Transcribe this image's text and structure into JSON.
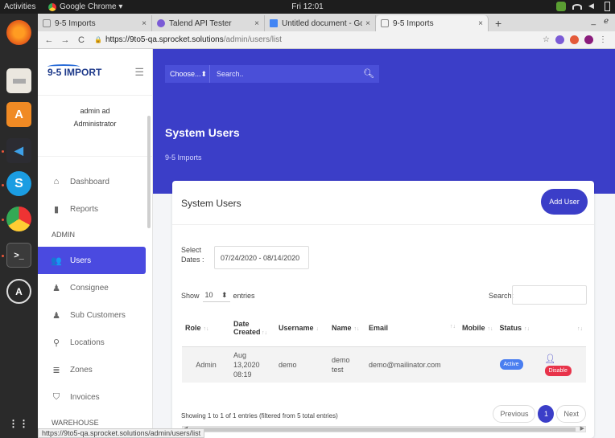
{
  "os": {
    "activities": "Activities",
    "app_name": "Google Chrome ▾",
    "clock": "Fri 12:01"
  },
  "tabs": [
    {
      "label": "9-5 Imports",
      "active": false
    },
    {
      "label": "Talend API Tester",
      "active": false
    },
    {
      "label": "Untitled document - Goog",
      "active": false
    },
    {
      "label": "9-5 Imports",
      "active": true
    }
  ],
  "address": {
    "domain": "https://9to5-qa.sprocket.solutions",
    "path": "/admin/users/list"
  },
  "sidebar": {
    "logo": "9-5 IMPORT",
    "user_name": "admin ad",
    "user_role": "Administrator",
    "items": [
      {
        "label": "Dashboard",
        "icon": "home-icon"
      },
      {
        "label": "Reports",
        "icon": "document-icon"
      }
    ],
    "section_admin": "ADMIN",
    "admin_items": [
      {
        "label": "Users",
        "icon": "users-icon",
        "active": true
      },
      {
        "label": "Consignee",
        "icon": "person-icon"
      },
      {
        "label": "Sub Customers",
        "icon": "person-icon"
      },
      {
        "label": "Locations",
        "icon": "map-pin-icon"
      },
      {
        "label": "Zones",
        "icon": "list-icon"
      },
      {
        "label": "Invoices",
        "icon": "shield-icon"
      }
    ],
    "section_warehouse": "WAREHOUSE"
  },
  "topnav": {
    "choose": "Choose...",
    "search_placeholder": "Search.."
  },
  "hero": {
    "title": "System Users",
    "breadcrumb": "9-5 Imports"
  },
  "card": {
    "title": "System Users",
    "add_user": "Add User",
    "select_dates_label": "Select Dates :",
    "date_range": "07/24/2020 - 08/14/2020",
    "show": "Show",
    "entries_count": "10",
    "entries": "entries",
    "search_label": "Search:"
  },
  "table": {
    "headers": [
      "Role",
      "Date Created",
      "Username",
      "Name",
      "Email",
      "Mobile",
      "Status",
      ""
    ],
    "rows": [
      {
        "role": "Admin",
        "date_created": "Aug 13,2020 08:19",
        "username": "demo",
        "name": "demo test",
        "email": "demo@mailinator.com",
        "mobile": "",
        "status": "Active",
        "action": "Disable"
      }
    ]
  },
  "footer": {
    "info": "Showing 1 to 1 of 1 entries (filtered from 5 total entries)",
    "previous": "Previous",
    "page": "1",
    "next": "Next"
  },
  "status_url": "https://9to5-qa.sprocket.solutions/admin/users/list",
  "colors": {
    "primary": "#3b3ec8",
    "active_badge": "#4a7ef0",
    "disable_badge": "#e8334a"
  }
}
